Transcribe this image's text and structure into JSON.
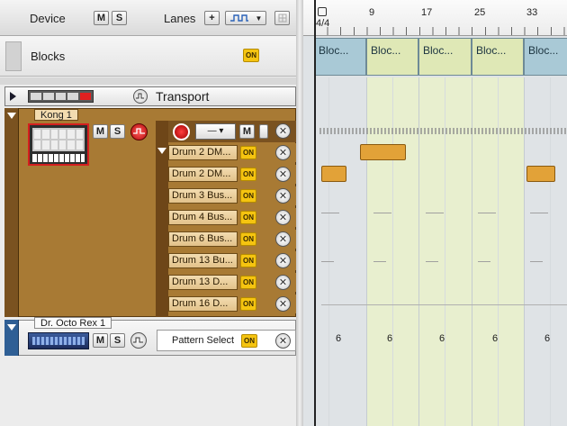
{
  "header": {
    "device_label": "Device",
    "m_label": "M",
    "s_label": "S",
    "lanes_label": "Lanes",
    "add_label": "+"
  },
  "blocks_row": {
    "label": "Blocks",
    "on_label": "ON"
  },
  "transport": {
    "label": "Transport"
  },
  "kong": {
    "name": "Kong 1",
    "m_label": "M",
    "s_label": "S",
    "lanes": [
      {
        "label": "Drum 2 DM...",
        "on": "ON"
      },
      {
        "label": "Drum 2 DM...",
        "on": "ON"
      },
      {
        "label": "Drum 3 Bus...",
        "on": "ON"
      },
      {
        "label": "Drum 4 Bus...",
        "on": "ON"
      },
      {
        "label": "Drum 6 Bus...",
        "on": "ON"
      },
      {
        "label": "Drum 13 Bu...",
        "on": "ON"
      },
      {
        "label": "Drum 13 D...",
        "on": "ON"
      },
      {
        "label": "Drum 16 D...",
        "on": "ON"
      }
    ]
  },
  "octo": {
    "name": "Dr. Octo Rex 1",
    "m_label": "M",
    "s_label": "S",
    "lane_label": "Pattern Select",
    "on_label": "ON"
  },
  "ruler": {
    "time_sig": "4/4",
    "bars": [
      "9",
      "17",
      "25",
      "33"
    ]
  },
  "blocks": [
    "Bloc...",
    "Bloc...",
    "Bloc...",
    "Bloc...",
    "Bloc..."
  ],
  "pattern_values": [
    "6",
    "6",
    "6",
    "6",
    "6"
  ],
  "colors": {
    "on_button": "#f5c410",
    "kong_panel": "#a87a34",
    "block_blue": "#a9c9d6",
    "block_green": "#dfe8b6",
    "clip_orange": "#e2a238"
  }
}
